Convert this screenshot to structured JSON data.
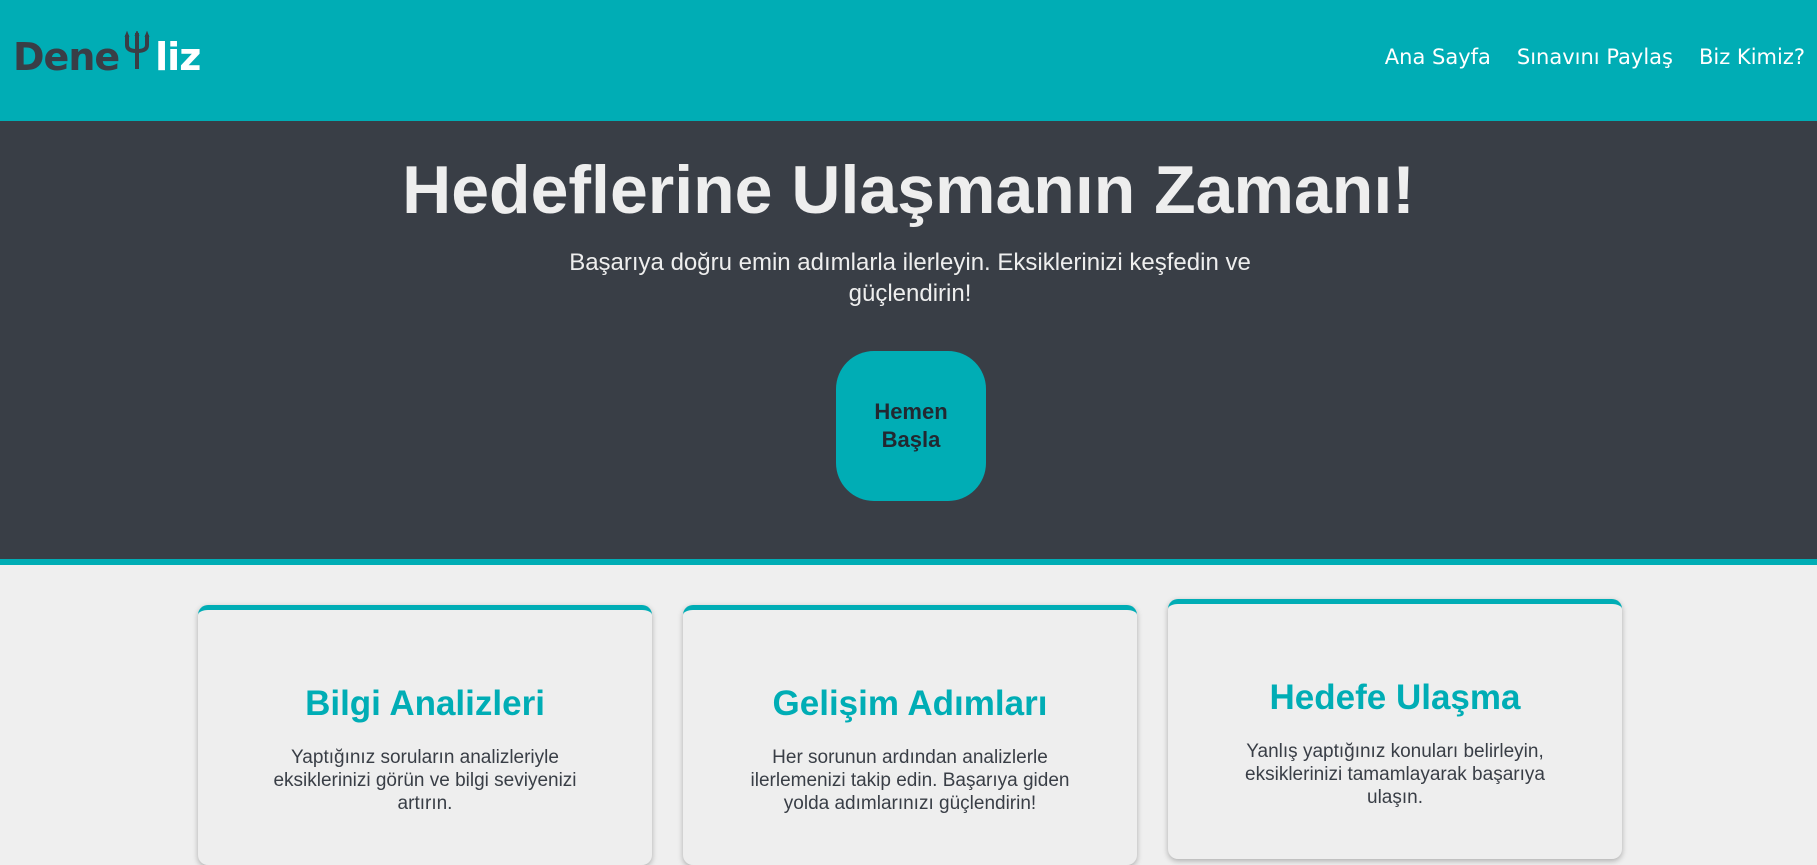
{
  "header": {
    "logo": {
      "part1": "Dene",
      "part2": "liz",
      "icon": "trident-icon"
    },
    "nav": [
      {
        "label": "Ana Sayfa"
      },
      {
        "label": "Sınavını Paylaş"
      },
      {
        "label": "Biz Kimiz?"
      }
    ]
  },
  "hero": {
    "title": "Hedeflerine Ulaşmanın Zamanı!",
    "subtitle": "Başarıya doğru emin adımlarla ilerleyin. Eksiklerinizi keşfedin ve güçlendirin!",
    "button_label": "Hemen Başla"
  },
  "features": [
    {
      "title": "Bilgi Analizleri",
      "text": "Yaptığınız soruların analizleriyle eksiklerinizi görün ve bilgi seviyenizi artırın."
    },
    {
      "title": "Gelişim Adımları",
      "text": "Her sorunun ardından analizlerle ilerlemenizi takip edin. Başarıya giden yolda adımlarınızı güçlendirin!"
    },
    {
      "title": "Hedefe Ulaşma",
      "text": "Yanlış yaptığınız konuları belirleyin, eksiklerinizi tamamlayarak başarıya ulaşın."
    }
  ],
  "colors": {
    "accent": "#00adb5",
    "dark": "#393e46",
    "light": "#eeeeee",
    "button_text": "#222831"
  }
}
